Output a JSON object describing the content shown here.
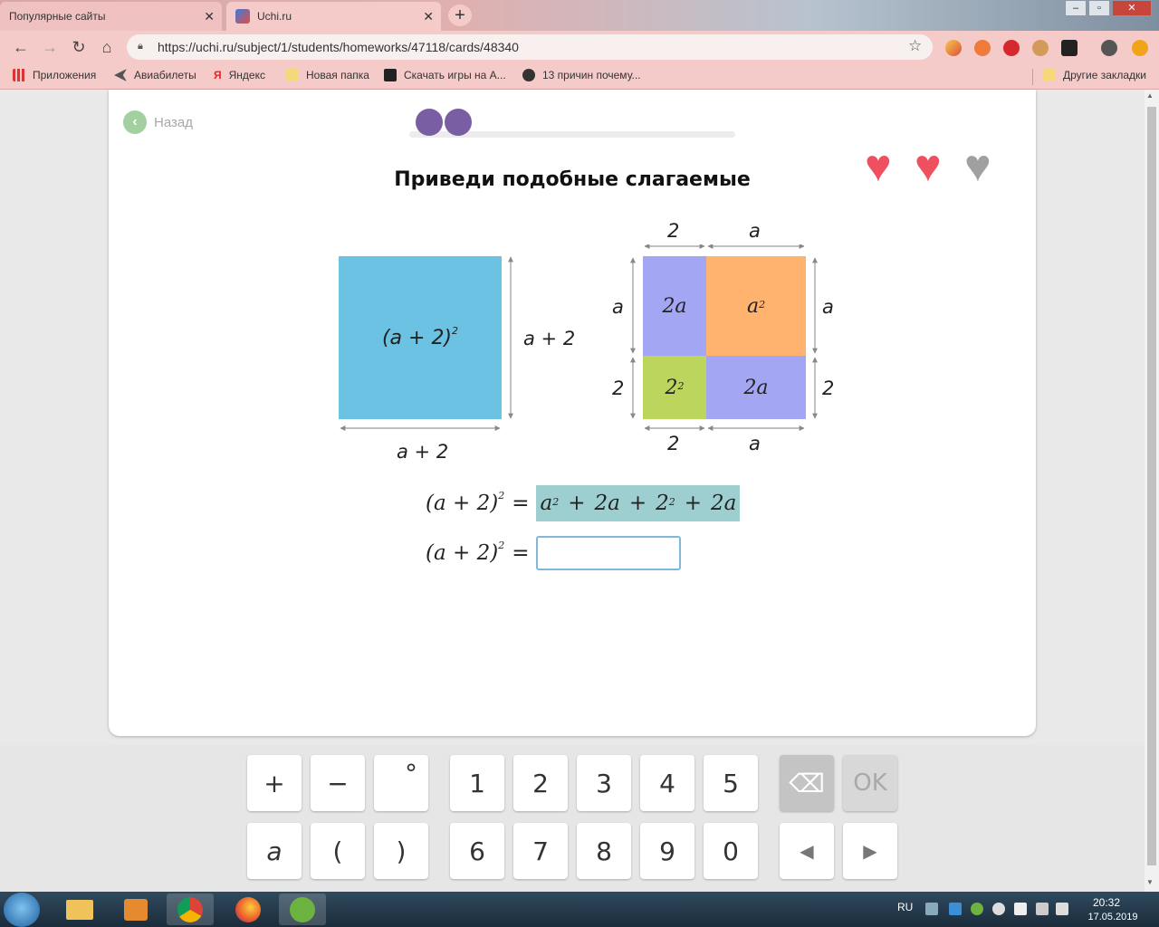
{
  "browser": {
    "tabs": [
      {
        "label": "Популярные сайты"
      },
      {
        "label": "Uchi.ru"
      }
    ],
    "new_tab": "+",
    "url": "https://uchi.ru/subject/1/students/homeworks/47118/cards/48340",
    "bookmarks": [
      {
        "label": "Приложения"
      },
      {
        "label": "Авиабилеты"
      },
      {
        "label": "Яндекс"
      },
      {
        "label": "Новая папка"
      },
      {
        "label": "Скачать игры на А..."
      },
      {
        "label": "13 причин почему..."
      }
    ],
    "other_bookmarks": "Другие закладки"
  },
  "lesson": {
    "back_label": "Назад",
    "progress_steps_done": 2,
    "lives": {
      "total": 3,
      "remaining": 2
    },
    "title": "Приведи подобные слагаемые"
  },
  "figure": {
    "big_square_label_base": "(a + 2)",
    "big_square_label_exp": "2",
    "side_right": "a + 2",
    "side_bottom": "a + 2",
    "top_labels": [
      "2",
      "a"
    ],
    "bottom_labels": [
      "2",
      "a"
    ],
    "left_labels": [
      "a",
      "2"
    ],
    "right_labels": [
      "a",
      "2"
    ],
    "cells": [
      {
        "text": "2a",
        "color": "#a3a6f3"
      },
      {
        "text": "a",
        "exp": "2",
        "color": "#ffb36f"
      },
      {
        "text": "2",
        "exp": "2",
        "color": "#bcd55c"
      },
      {
        "text": "2a",
        "color": "#a3a6f3"
      }
    ]
  },
  "equations": {
    "lhs_base": "(a + 2)",
    "lhs_exp": "2",
    "equals": "=",
    "answer_terms": [
      "a",
      "2",
      "+",
      "2a",
      "+",
      "2",
      "2",
      "+",
      "2a"
    ],
    "input_value": ""
  },
  "keypad": {
    "row1": [
      "+",
      "−",
      "°",
      "1",
      "2",
      "3",
      "4",
      "5"
    ],
    "row2": [
      "a",
      "(",
      ")",
      "6",
      "7",
      "8",
      "9",
      "0"
    ],
    "backspace": "⌫",
    "ok": "OK",
    "left": "◀",
    "right": "▶"
  },
  "taskbar": {
    "lang": "RU",
    "time": "20:32",
    "date": "17.05.2019"
  },
  "colors": {
    "accent": "#7a5ea3",
    "big_square": "#6cc2e2",
    "answer_highlight": "#9ecfd0",
    "heart_on": "#ef5060",
    "heart_off": "#a0a0a0"
  }
}
